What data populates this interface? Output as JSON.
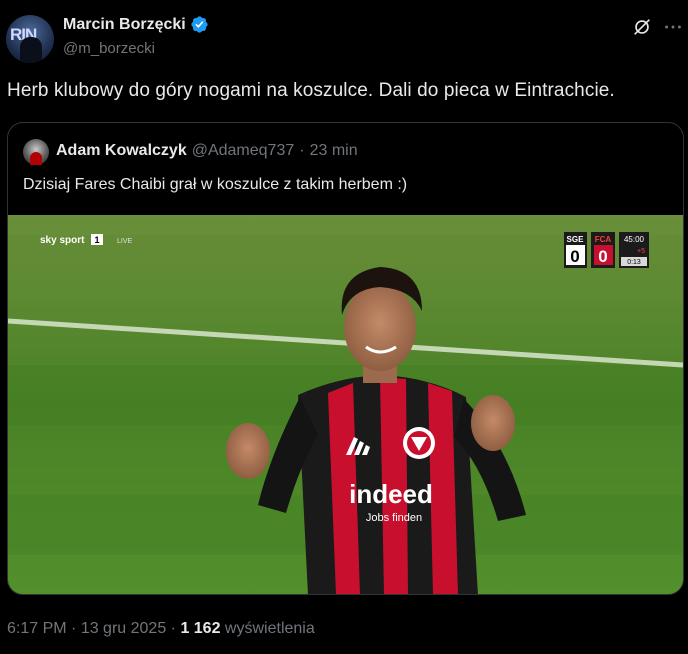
{
  "tweet": {
    "author": {
      "name": "Marcin Borzęcki",
      "handle": "@m_borzecki",
      "avatar_text": "RIN"
    },
    "text": "Herb klubowy do góry nogami na koszulce. Dali do pieca w Eintrachcie.",
    "footer": {
      "time": "6:17 PM",
      "sep1": " · ",
      "date": "13 gru 2025",
      "sep2": " · ",
      "views_count": "1 162",
      "views_label": " wyświetlenia"
    }
  },
  "quote": {
    "author": {
      "name": "Adam Kowalczyk",
      "handle": "@Adameq737",
      "dot": "·",
      "time": "23 min"
    },
    "text": "Dzisiaj Fares Chaibi grał w koszulce z takim herbem :)"
  },
  "media": {
    "broadcaster": "sky sport",
    "channel": "1",
    "live": "LIVE",
    "scoreboard": {
      "home_team": "SGE",
      "away_team": "FCA",
      "home_score": "0",
      "away_score": "0",
      "clock": "45:00",
      "added": "+5",
      "sub_clock": "0:13"
    },
    "sponsor": "indeed",
    "sponsor_sub": "Jobs finden"
  },
  "icons": {
    "verified": "verified-badge-icon",
    "grok": "grok-icon",
    "more": "more-options-icon"
  },
  "colors": {
    "verified": "#1d9bf0",
    "secondary": "#71767b",
    "jersey_red": "#c8102e",
    "pitch": "#4a8a2a"
  }
}
